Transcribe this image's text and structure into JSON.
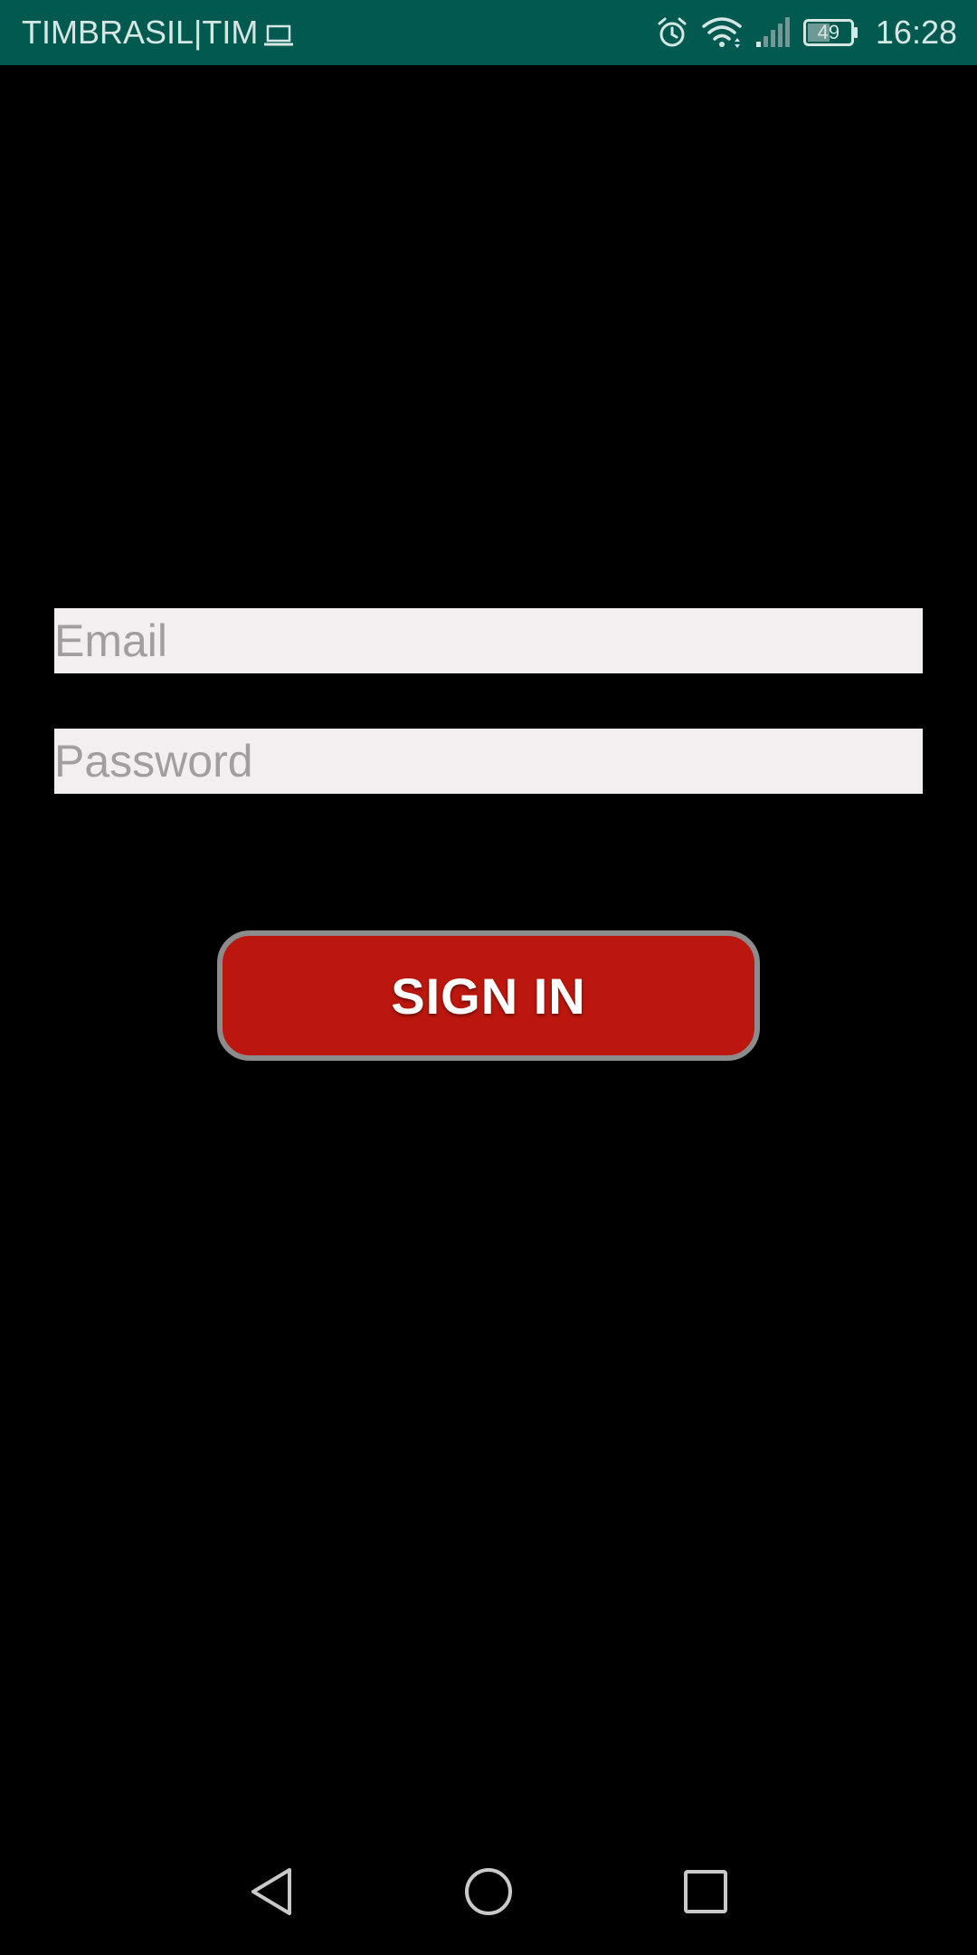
{
  "status_bar": {
    "carrier": "TIMBRASIL|TIM",
    "battery": "49",
    "time": "16:28",
    "icons": [
      "laptop-icon",
      "alarm-icon",
      "wifi-icon",
      "signal-icon",
      "battery-icon"
    ]
  },
  "form": {
    "email_placeholder": "Email",
    "email_value": "",
    "password_placeholder": "Password",
    "password_value": "",
    "sign_in_label": "SIGN IN"
  },
  "nav_bar": {
    "icons": [
      "back-icon",
      "home-icon",
      "recents-icon"
    ]
  },
  "colors": {
    "status_bar": "#02594f",
    "background": "#000000",
    "field_background": "#f3eff0",
    "button_fill": "#bb170e",
    "button_border": "#8c8c8c"
  }
}
